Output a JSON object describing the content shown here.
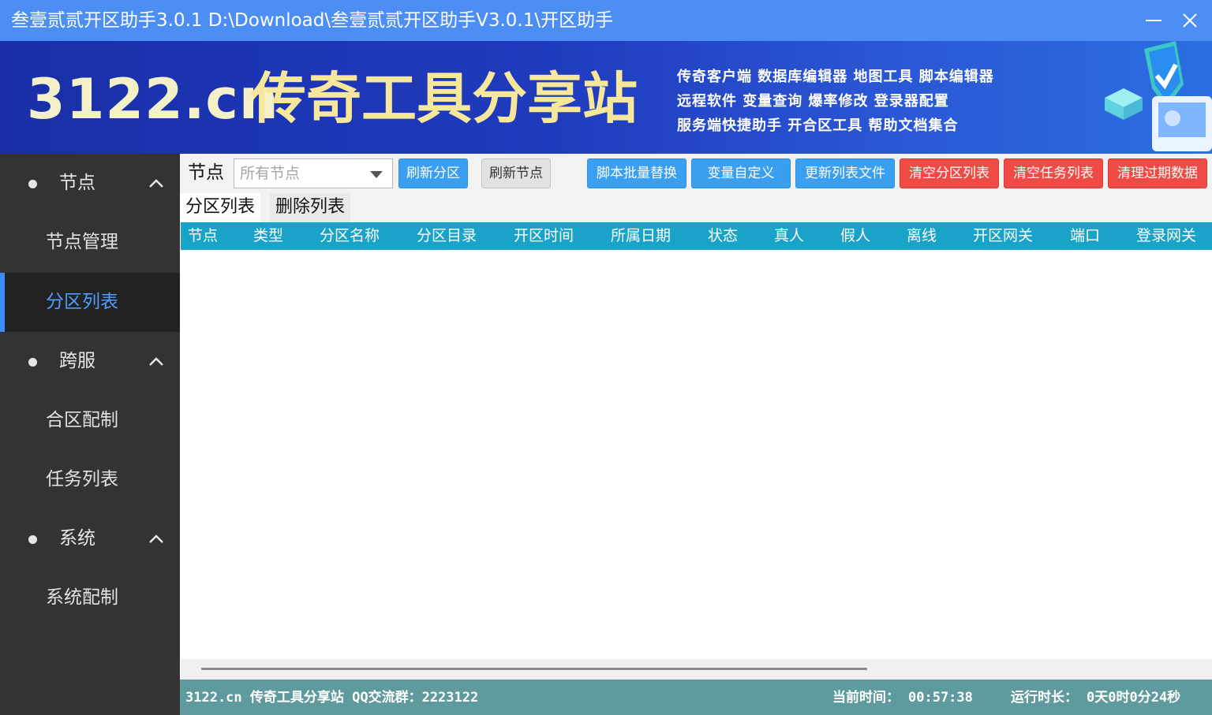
{
  "window": {
    "title": "叁壹贰贰开区助手3.0.1 D:\\Download\\叁壹贰贰开区助手V3.0.1\\开区助手",
    "minimize_icon": "minimize-icon",
    "close_icon": "close-icon"
  },
  "banner": {
    "logo": "3122.cn",
    "slogan": "传奇工具分享站",
    "links": [
      "传奇客户端 数据库编辑器 地图工具 脚本编辑器",
      "远程软件 变量查询 爆率修改 登录器配置",
      "服务端快捷助手 开合区工具 帮助文档集合"
    ],
    "decoration_icon": "shield-computer-illustration",
    "colors": {
      "background": "#1f3bbd",
      "logo": "#f4f0c8",
      "slogan": "#f6e79a"
    }
  },
  "sidebar": {
    "groups": [
      {
        "label": "节点",
        "expanded": true,
        "items": [
          "节点管理",
          "分区列表"
        ]
      },
      {
        "label": "跨服",
        "expanded": true,
        "items": [
          "合区配制",
          "任务列表"
        ]
      },
      {
        "label": "系统",
        "expanded": true,
        "items": [
          "系统配制"
        ]
      }
    ],
    "active_item": "分区列表",
    "colors": {
      "background": "#333333",
      "active_background": "#222222",
      "active_text": "#4d9dff"
    }
  },
  "toolbar": {
    "node_label": "节点",
    "node_select_placeholder": "所有节点",
    "buttons": {
      "refresh_partition": "刷新分区",
      "refresh_node": "刷新节点",
      "script_batch_replace": "脚本批量替换",
      "variable_custom": "变量自定义",
      "update_list_file": "更新列表文件",
      "clear_partition_list": "清空分区列表",
      "clear_task_list": "清空任务列表",
      "clean_expired_data": "清理过期数据"
    },
    "colors": {
      "blue": "#3a9ff0",
      "red": "#ef4b45"
    }
  },
  "tabs": [
    {
      "label": "分区列表",
      "active": true
    },
    {
      "label": "删除列表",
      "active": false
    }
  ],
  "table": {
    "columns": [
      "节点",
      "类型",
      "分区名称",
      "分区目录",
      "开区时间",
      "所属日期",
      "状态",
      "真人",
      "假人",
      "离线",
      "开区网关",
      "端口",
      "登录网关"
    ],
    "rows": [],
    "header_color": "#1aa3c9"
  },
  "statusbar": {
    "site_info": "3122.cn 传奇工具分享站 QQ交流群：2223122",
    "current_time_label": "当前时间：",
    "current_time": "00:57:38",
    "run_time_label": "运行时长：",
    "run_time": "0天0时0分24秒",
    "color": "#5f9a9e"
  }
}
